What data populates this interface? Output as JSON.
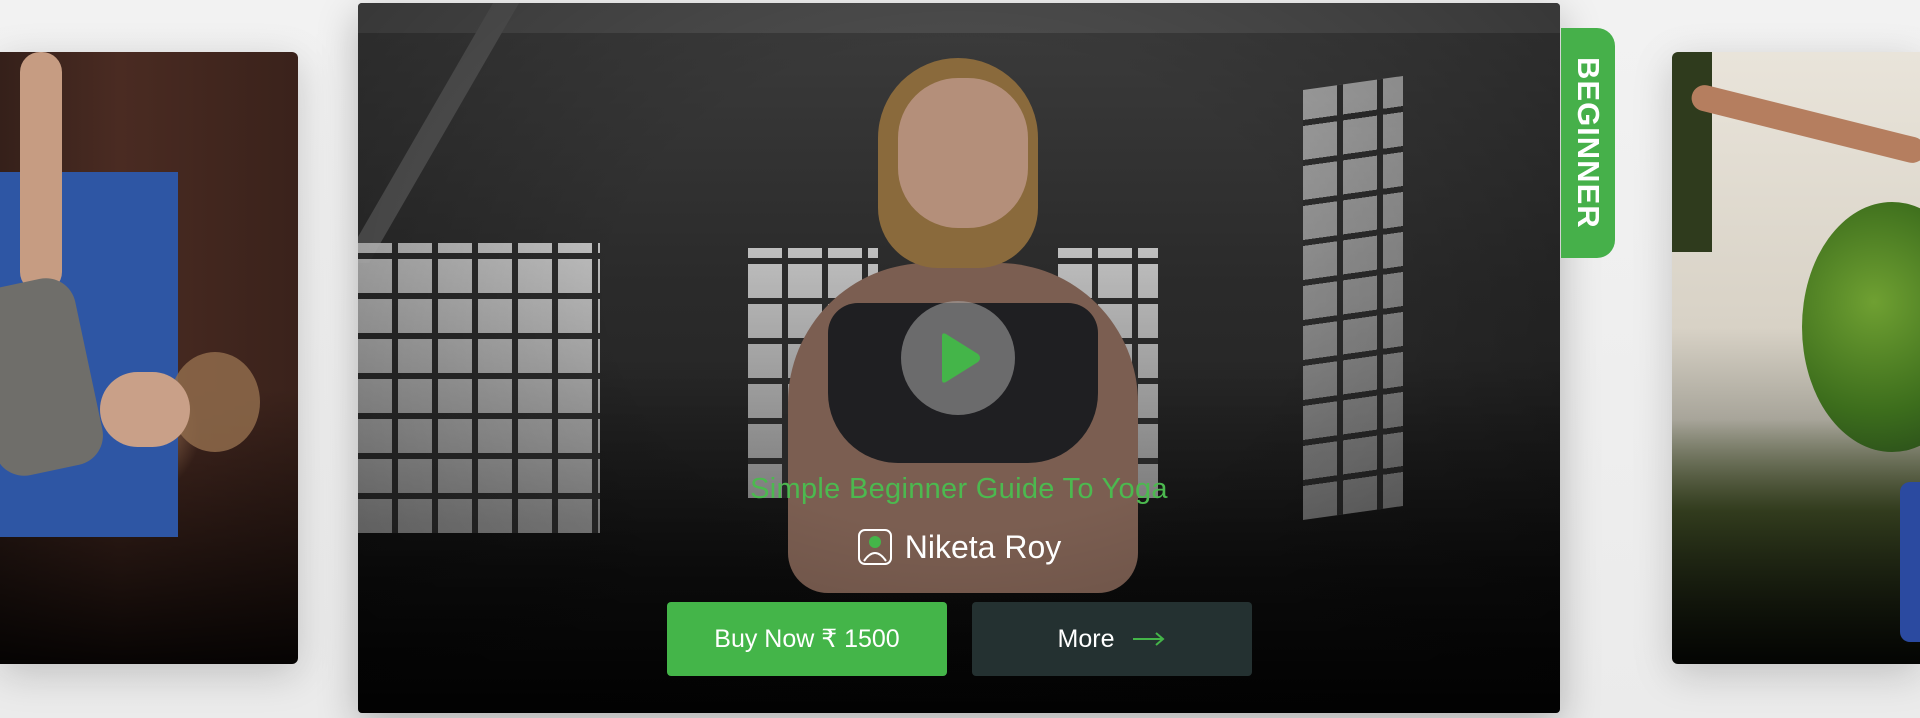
{
  "course": {
    "title": "Simple Beginner Guide To Yoga",
    "instructor": "Niketa Roy",
    "level": "BEGINNER"
  },
  "actions": {
    "buy_label": "Buy Now ₹ 1500",
    "more_label": "More"
  },
  "icons": {
    "play": "play-icon",
    "instructor": "person-icon",
    "more": "arrow-right-icon"
  },
  "colors": {
    "accent": "#44b549",
    "more_button": "#243131",
    "title_text": "#4cb94f"
  }
}
